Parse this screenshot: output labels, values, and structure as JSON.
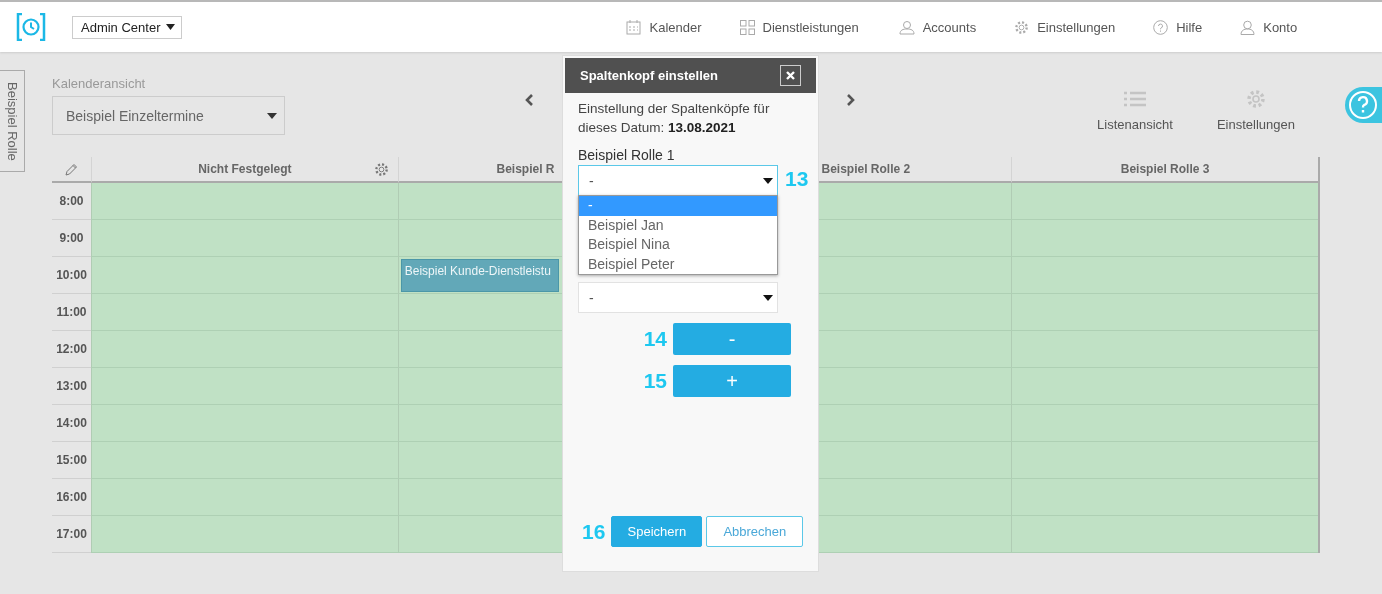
{
  "header": {
    "account_menu": {
      "label": "Admin Center"
    },
    "nav": [
      {
        "label": "Kalender",
        "kind": "calendar"
      },
      {
        "label": "Dienstleistungen",
        "kind": "grid"
      },
      {
        "label": "Accounts",
        "kind": "users"
      },
      {
        "label": "Einstellungen",
        "kind": "gear"
      },
      {
        "label": "Hilfe",
        "kind": "help"
      },
      {
        "label": "Konto",
        "kind": "user"
      }
    ]
  },
  "side_tab": {
    "label": "Beispiel Rolle"
  },
  "toolbar": {
    "view_label": "Kalenderansicht",
    "view_select": {
      "value": "Beispiel Einzeltermine"
    },
    "actions": [
      {
        "label": "Listenansicht",
        "kind": "list"
      },
      {
        "label": "Einstellungen",
        "kind": "gear"
      }
    ]
  },
  "calendar": {
    "columns": [
      {
        "title": "Nicht Festgelegt",
        "settings": true
      },
      {
        "title": "Beispiel R",
        "settings": false
      },
      {
        "title": "Beispiel Rolle 2",
        "settings": false
      },
      {
        "title": "Beispiel Rolle 3",
        "settings": false
      }
    ],
    "rows": [
      {
        "time": "8:00"
      },
      {
        "time": "9:00"
      },
      {
        "time": "10:00",
        "cells": [
          null,
          "Beispiel Kunde-Dienstleistu",
          null,
          null
        ]
      },
      {
        "time": "11:00"
      },
      {
        "time": "12:00"
      },
      {
        "time": "13:00"
      },
      {
        "time": "14:00"
      },
      {
        "time": "15:00"
      },
      {
        "time": "16:00"
      },
      {
        "time": "17:00"
      }
    ]
  },
  "modal": {
    "title": "Spaltenkopf einstellen",
    "intro": "Einstellung der Spaltenköpfe für dieses Datum: **13.08.2021**",
    "fields": [
      {
        "label": "Beispiel Rolle 1",
        "value": "-",
        "open": true,
        "callout": "13",
        "options": [
          {
            "label": "-",
            "selected": true
          },
          {
            "label": "Beispiel Jan",
            "selected": false
          },
          {
            "label": "Beispiel Nina",
            "selected": false
          },
          {
            "label": "Beispiel Peter",
            "selected": false
          }
        ]
      },
      {
        "value": "-",
        "open": false
      }
    ],
    "buttons": [
      {
        "label": "-",
        "callout": "14"
      },
      {
        "label": "+",
        "callout": "15"
      }
    ],
    "footer": {
      "callout": "16",
      "buttons": [
        {
          "label": "Speichern",
          "kind": "primary"
        },
        {
          "label": "Abbrechen",
          "kind": "secondary"
        }
      ]
    }
  }
}
